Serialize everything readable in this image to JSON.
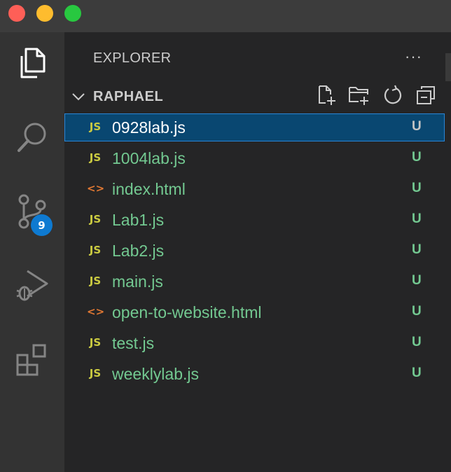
{
  "explorer": {
    "title": "EXPLORER",
    "more_actions": "···",
    "folder": "RAPHAEL"
  },
  "activity_bar": {
    "source_control_badge": "9",
    "items": [
      "files-icon",
      "search-icon",
      "source-control-icon",
      "run-debug-icon",
      "extensions-icon"
    ]
  },
  "header_actions": [
    "new-file-icon",
    "new-folder-icon",
    "refresh-icon",
    "collapse-all-icon"
  ],
  "files": [
    {
      "name": "0928lab.js",
      "icon_text": "JS",
      "type": "js",
      "status": "U",
      "selected": true
    },
    {
      "name": "1004lab.js",
      "icon_text": "JS",
      "type": "js",
      "status": "U"
    },
    {
      "name": "index.html",
      "icon_text": "<>",
      "type": "html",
      "status": "U"
    },
    {
      "name": "Lab1.js",
      "icon_text": "JS",
      "type": "js",
      "status": "U"
    },
    {
      "name": "Lab2.js",
      "icon_text": "JS",
      "type": "js",
      "status": "U"
    },
    {
      "name": "main.js",
      "icon_text": "JS",
      "type": "js",
      "status": "U"
    },
    {
      "name": "open-to-website.html",
      "icon_text": "<>",
      "type": "html",
      "status": "U"
    },
    {
      "name": "test.js",
      "icon_text": "JS",
      "type": "js",
      "status": "U"
    },
    {
      "name": "weeklylab.js",
      "icon_text": "JS",
      "type": "js",
      "status": "U"
    }
  ],
  "colors": {
    "untracked": "#73c991",
    "selection": "#094771",
    "badge": "#0e7ad1",
    "js_icon": "#cbcb41",
    "html_icon": "#e37933"
  }
}
